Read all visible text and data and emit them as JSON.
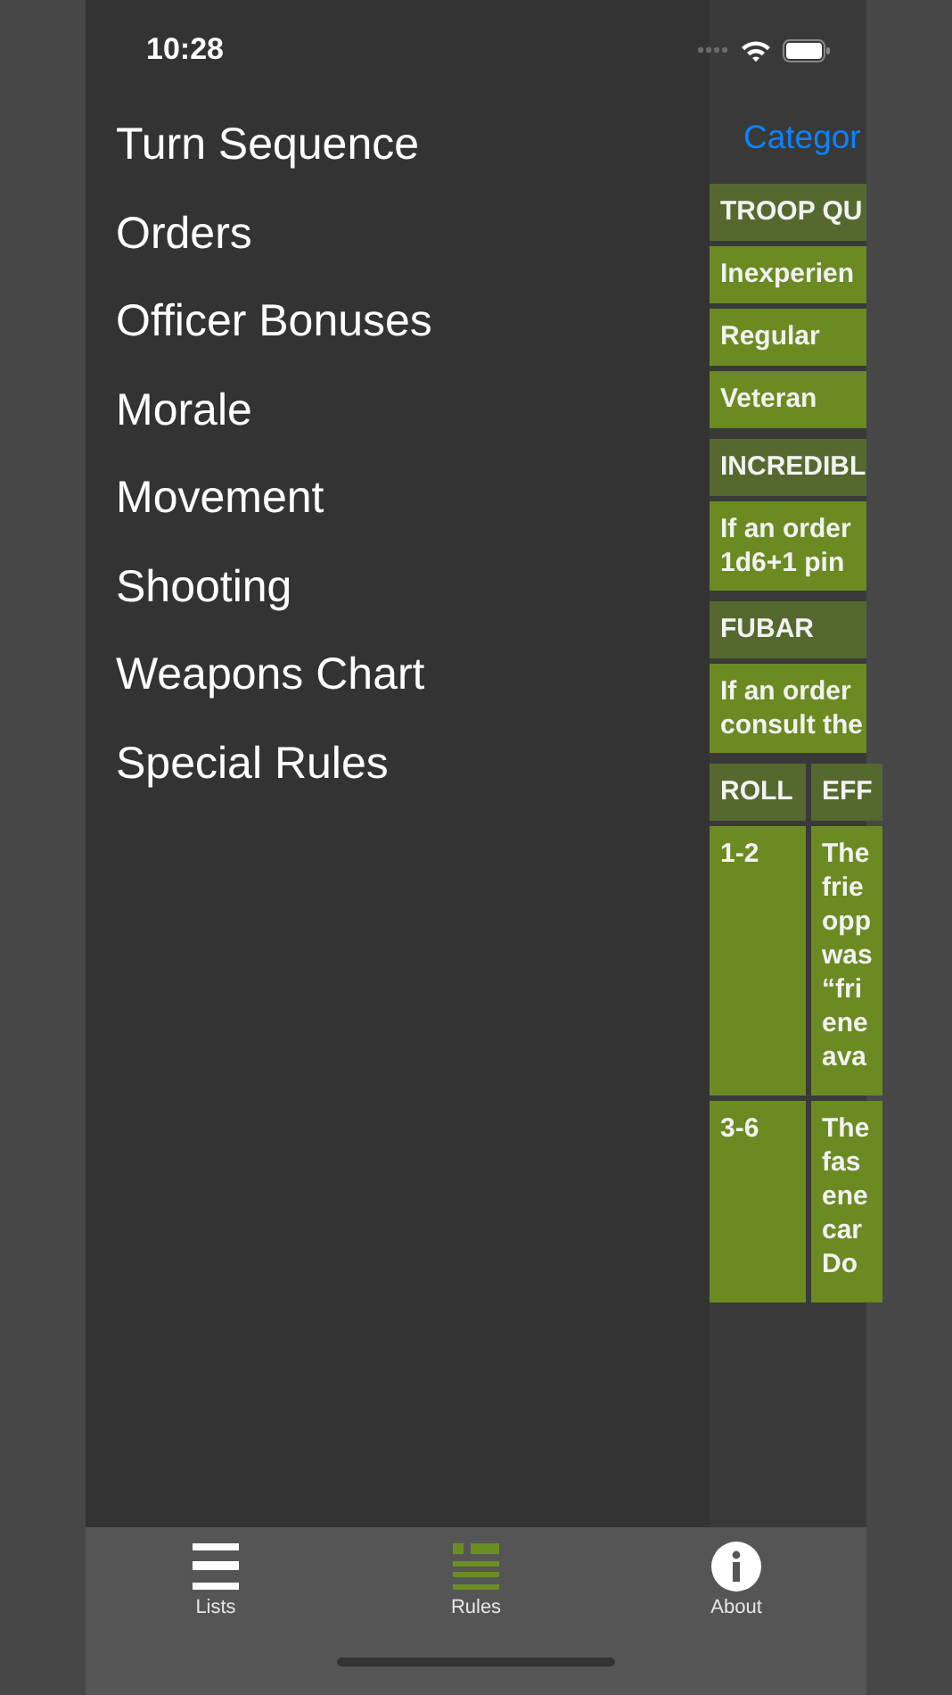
{
  "status_bar": {
    "time": "10:28"
  },
  "menu": {
    "items": [
      {
        "label": "Turn Sequence"
      },
      {
        "label": "Orders"
      },
      {
        "label": "Officer Bonuses"
      },
      {
        "label": "Morale"
      },
      {
        "label": "Movement"
      },
      {
        "label": "Shooting"
      },
      {
        "label": "Weapons Chart"
      },
      {
        "label": "Special Rules"
      }
    ]
  },
  "content": {
    "link": "Categor",
    "sections": [
      {
        "kind": "list",
        "header": "TROOP QU",
        "rows": [
          "Inexperien",
          "Regular",
          "Veteran"
        ]
      },
      {
        "kind": "note",
        "header": "INCREDIBL",
        "text": "If an order\n1d6+1 pin"
      },
      {
        "kind": "note",
        "header": "FUBAR",
        "text": "If an order\nconsult the"
      },
      {
        "kind": "grid",
        "columns": [
          "ROLL",
          "EFF"
        ],
        "rows": [
          {
            "cells": [
              "1-2",
              "The\nfrie\nopp\nwas\n“fri\nene\nava"
            ]
          },
          {
            "cells": [
              "3-6",
              "The\nfas\nene\ncar\nDo"
            ]
          }
        ]
      }
    ]
  },
  "tab_bar": {
    "tabs": [
      {
        "label": "Lists",
        "kind": "lists",
        "selected": false
      },
      {
        "label": "Rules",
        "kind": "rules",
        "selected": true
      },
      {
        "label": "About",
        "kind": "about",
        "selected": false
      }
    ]
  }
}
